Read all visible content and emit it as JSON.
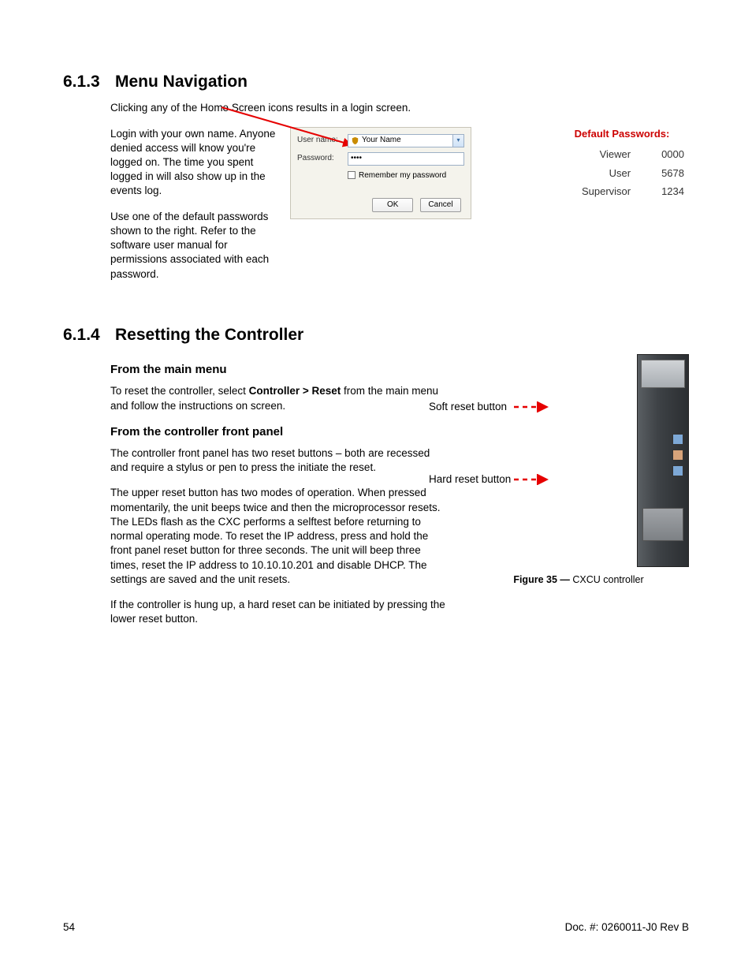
{
  "section_613": {
    "num": "6.1.3",
    "title": "Menu Navigation",
    "intro": "Clicking any of the Home Screen icons results in a login screen.",
    "p1": "Login with your own name. Anyone denied access will know you're logged on. The time you spent logged in will also show up in the events log.",
    "p2": "Use one of the default passwords shown to the right. Refer to the software user manual for permissions associated with each password."
  },
  "login_dialog": {
    "username_label": "User name:",
    "username_value": "Your Name",
    "password_label": "Password:",
    "password_mask": "••••",
    "remember_label": "Remember my password",
    "ok_label": "OK",
    "cancel_label": "Cancel"
  },
  "passwords": {
    "heading": "Default Passwords:",
    "rows": [
      {
        "role": "Viewer",
        "pw": "0000"
      },
      {
        "role": "User",
        "pw": "5678"
      },
      {
        "role": "Supervisor",
        "pw": "1234"
      }
    ]
  },
  "section_614": {
    "num": "6.1.4",
    "title": "Resetting the Controller",
    "sub1": "From the main menu",
    "s1p1_a": "To reset the controller, select ",
    "s1p1_bold": "Controller > Reset",
    "s1p1_b": " from the main menu and follow the instructions on screen.",
    "sub2": "From the controller front panel",
    "s2p1": "The controller front panel has two reset buttons – both are recessed and require a stylus or pen to press the initiate the reset.",
    "s2p2": "The upper reset button has two modes of operation. When pressed momentarily, the unit beeps twice and then the microprocessor resets. The LEDs flash as the CXC performs a selftest before returning to normal operating mode. To reset the IP address, press and hold the front panel reset button for three seconds. The unit will beep three times, reset the IP address to 10.10.10.201 and disable DHCP. The settings are saved and the unit resets.",
    "s2p3": "If the controller is hung up, a hard reset can be initiated by pressing the lower reset button.",
    "soft_label": "Soft reset button",
    "hard_label": "Hard reset button",
    "fig_caption_bold": "Figure 35 — ",
    "fig_caption_rest": "CXCU controller"
  },
  "footer": {
    "page": "54",
    "doc": "Doc. #: 0260011-J0    Rev B"
  }
}
